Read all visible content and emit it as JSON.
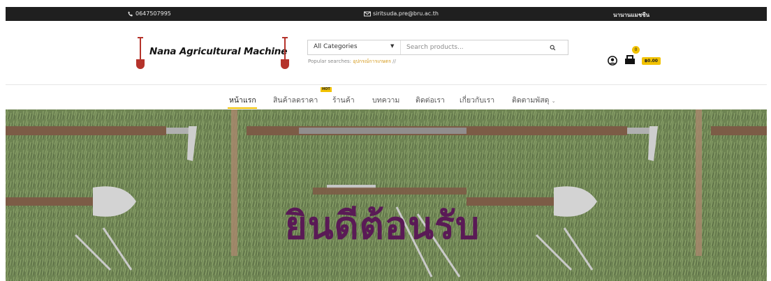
{
  "topbar": {
    "phone": "0647507995",
    "email": "siritsuda.pre@bru.ac.th",
    "user": "นานานแมชชีน",
    "icons": {
      "phone": "phone-icon",
      "email": "envelope-icon"
    }
  },
  "header": {
    "logo_text": "Nana Agricultural Machine",
    "search": {
      "category": "All Categories",
      "placeholder": "Search products..."
    },
    "popular_label": "Popular searches:",
    "popular_tag": "อุปกรณ์การเกษตร",
    "popular_sep": "//",
    "cart_count": "0",
    "cart_total": "฿0.00"
  },
  "nav": {
    "items": [
      {
        "label": "หน้าแรก"
      },
      {
        "label": "สินค้าลดราคา"
      },
      {
        "label": "ร้านค้า"
      },
      {
        "label": "บทความ"
      },
      {
        "label": "ติดต่อเรา"
      },
      {
        "label": "เกี่ยวกับเรา"
      },
      {
        "label": "ติดตามพัสดุ"
      }
    ],
    "hot_badge": "HOT",
    "dropdown_icon": "chevron-down-icon"
  },
  "hero": {
    "title": "ยินดีต้อนรับ"
  },
  "colors": {
    "accent": "#f2c200",
    "topbar": "#1f1f1f",
    "hero_title": "#5a1a56",
    "logo_shovel": "#b5332b"
  }
}
